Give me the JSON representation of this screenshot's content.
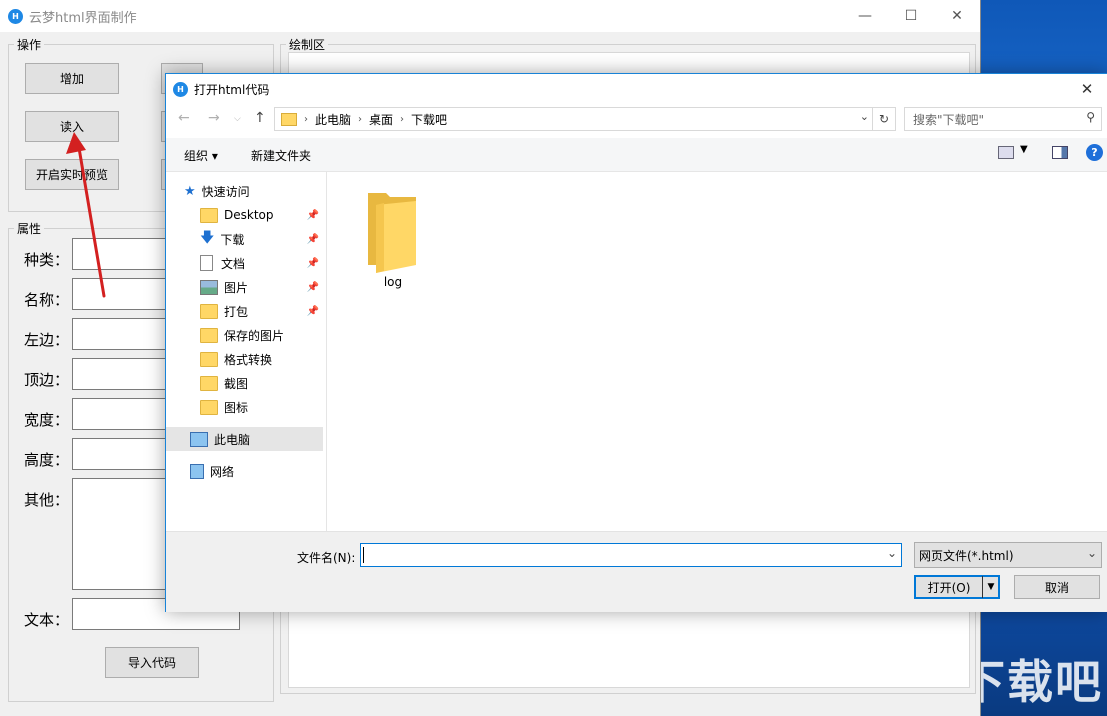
{
  "app": {
    "title": "云梦html界面制作",
    "ops_group": "操作",
    "props_group": "属性",
    "canvas_group": "绘制区",
    "buttons": {
      "add": "增加",
      "read": "读入",
      "preview": "开启实时预览",
      "import": "导入代码"
    },
    "props": {
      "kind": "种类：",
      "name": "名称：",
      "left": "左边：",
      "top": "顶边：",
      "width": "宽度：",
      "height": "高度：",
      "other": "其他：",
      "text": "文本："
    }
  },
  "dialog": {
    "title": "打开html代码",
    "breadcrumb": [
      "此电脑",
      "桌面",
      "下载吧"
    ],
    "search_placeholder": "搜索\"下载吧\"",
    "toolbar": {
      "organize": "组织 ▾",
      "new_folder": "新建文件夹"
    },
    "nav": {
      "quick_access": "快速访问",
      "items": [
        "Desktop",
        "下载",
        "文档",
        "图片",
        "打包",
        "保存的图片",
        "格式转换",
        "截图",
        "图标"
      ],
      "this_pc": "此电脑",
      "network": "网络"
    },
    "files": [
      {
        "name": "log"
      }
    ],
    "filename_label": "文件名(N):",
    "filename_value": "",
    "filetype": "网页文件(*.html)",
    "open_button": "打开(O)",
    "cancel_button": "取消"
  },
  "watermark": "下载吧"
}
